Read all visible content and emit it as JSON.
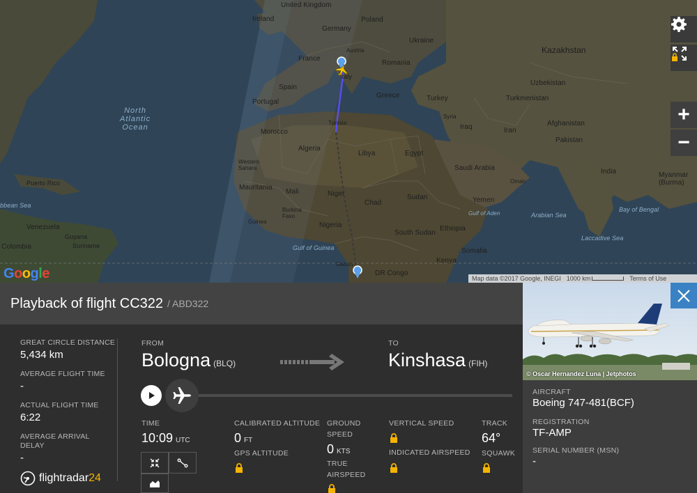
{
  "map": {
    "labels": {
      "united_kingdom": "United Kingdom",
      "ireland": "Ireland",
      "poland": "Poland",
      "germany": "Germany",
      "ukraine": "Ukraine",
      "france": "France",
      "austria": "Austria",
      "romania": "Romania",
      "italy": "Italy",
      "kazakhstan": "Kazakhstan",
      "spain": "Spain",
      "portugal": "Portugal",
      "uzbekistan": "Uzbekistan",
      "greece": "Greece",
      "turkey": "Turkey",
      "turkmenistan": "Turkmenistan",
      "tunisia": "Tunisia",
      "syria": "Syria",
      "afghanistan": "Afghanistan",
      "morocco": "Morocco",
      "iraq": "Iraq",
      "iran": "Iran",
      "pakistan": "Pakistan",
      "algeria": "Algeria",
      "libya": "Libya",
      "egypt": "Egypt",
      "western_sahara": "Western Sahara",
      "saudi_arabia": "Saudi Arabia",
      "india": "India",
      "myanmar": "Myanmar (Burma)",
      "oman": "Oman",
      "puerto_rico": "Puerto Rico",
      "mauritania": "Mauritania",
      "mali": "Mali",
      "niger": "Niger",
      "sudan": "Sudan",
      "yemen": "Yemen",
      "chad": "Chad",
      "burkina_faso": "Burkina Faso",
      "guinea": "Guinea",
      "nigeria": "Nigeria",
      "south_sudan": "South Sudan",
      "ethiopia": "Ethiopia",
      "venezuela": "Venezuela",
      "guyana": "Guyana",
      "suriname": "Suriname",
      "colombia": "Colombia",
      "somalia": "Somalia",
      "kenya": "Kenya",
      "gabon": "Gabon",
      "dr_congo": "DR Congo",
      "north_atlantic": "North\nAtlantic\nOcean",
      "caribbean_sea": "bbean Sea",
      "gulf_of_guinea": "Gulf of Guinea",
      "gulf_of_aden": "Gulf of Aden",
      "arabian_sea": "Arabian Sea",
      "bay_of_bengal": "Bay of Bengal",
      "laccadive_sea": "Laccadive Sea"
    },
    "attribution": {
      "map_data": "Map data ©2017 Google, INEGI",
      "scale": "1000 km",
      "terms": "Terms of Use"
    },
    "google_logo": [
      "G",
      "o",
      "o",
      "g",
      "l",
      "e"
    ],
    "google_colors": [
      "#4285F4",
      "#EA4335",
      "#FBBC05",
      "#4285F4",
      "#34A853",
      "#EA4335"
    ],
    "route_color": "#5a4ee8",
    "icons": {
      "settings": "gear-icon",
      "fullscreen": "fullscreen-lock-icon",
      "zoom_in": "+",
      "zoom_out": "−"
    }
  },
  "panel": {
    "title": "Playback of flight CC322",
    "callsign": "/ ABD322"
  },
  "stats": {
    "great_circle_label": "GREAT CIRCLE DISTANCE",
    "great_circle_value": "5,434 km",
    "avg_flight_time_label": "AVERAGE FLIGHT TIME",
    "avg_flight_time_value": "-",
    "actual_flight_time_label": "ACTUAL FLIGHT TIME",
    "actual_flight_time_value": "6:22",
    "avg_arrival_delay_label": "AVERAGE ARRIVAL DELAY",
    "avg_arrival_delay_value": "-"
  },
  "route": {
    "from_label": "FROM",
    "from_city": "Bologna",
    "from_code": "(BLQ)",
    "to_label": "TO",
    "to_city": "Kinshasa",
    "to_code": "(FIH)"
  },
  "playback": {
    "progress": 0
  },
  "telemetry": {
    "time_label": "TIME",
    "time_value": "10:09",
    "time_unit": "UTC",
    "cal_alt_label": "CALIBRATED ALTITUDE",
    "cal_alt_value": "0",
    "cal_alt_unit": "FT",
    "gps_alt_label": "GPS ALTITUDE",
    "ground_speed_label": "GROUND SPEED",
    "ground_speed_value": "0",
    "ground_speed_unit": "KTS",
    "true_airspeed_label": "TRUE AIRSPEED",
    "vertical_speed_label": "VERTICAL SPEED",
    "indicated_airspeed_label": "INDICATED AIRSPEED",
    "track_label": "TRACK",
    "track_value": "64°",
    "squawk_label": "SQUAWK"
  },
  "brand": {
    "name_text": "flightradar",
    "name_num": "24",
    "accent": "#f5b400"
  },
  "aircraft": {
    "photo_credit": "© Oscar Hernandez Luna | Jetphotos",
    "aircraft_label": "AIRCRAFT",
    "aircraft_value": "Boeing 747-481(BCF)",
    "registration_label": "REGISTRATION",
    "registration_value": "TF-AMP",
    "serial_label": "SERIAL NUMBER (MSN)",
    "serial_value": "-"
  },
  "colors": {
    "close_button": "#3b82c4",
    "panel_bg": "#2e2e2e",
    "header_bg": "#434343",
    "lock": "#f5b400"
  }
}
